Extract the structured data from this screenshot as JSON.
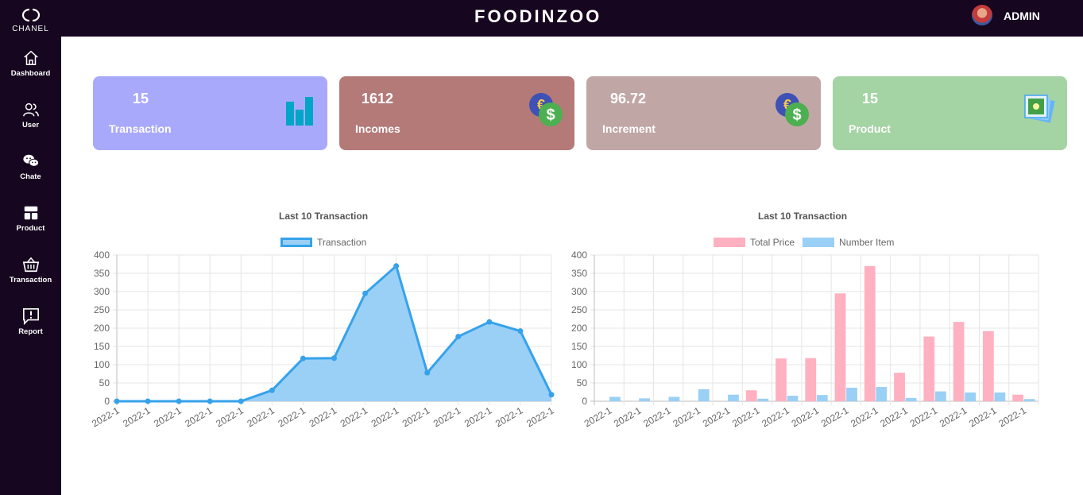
{
  "sidebar": {
    "logo_text": "CHANEL",
    "items": [
      {
        "label": "Dashboard",
        "icon": "home-icon"
      },
      {
        "label": "User",
        "icon": "users-icon"
      },
      {
        "label": "Chate",
        "icon": "chat-icon"
      },
      {
        "label": "Product",
        "icon": "product-icon"
      },
      {
        "label": "Transaction",
        "icon": "basket-icon"
      },
      {
        "label": "Report",
        "icon": "report-icon"
      }
    ]
  },
  "header": {
    "title": "FOODINZOO",
    "user": "ADMIN"
  },
  "cards": [
    {
      "value": "15",
      "label": "Transaction",
      "color": "#a9a9fc",
      "icon": "bar-chart-icon"
    },
    {
      "value": "1612",
      "label": "Incomes",
      "color": "#b37a78",
      "icon": "currency-icon"
    },
    {
      "value": "96.72",
      "label": "Increment",
      "color": "#c1a6a6",
      "icon": "currency-icon"
    },
    {
      "value": "15",
      "label": "Product",
      "color": "#a4d3a4",
      "icon": "photo-stack-icon"
    }
  ],
  "chart_data": [
    {
      "type": "area",
      "title": "Last 10 Transaction",
      "categories": [
        "2022-1",
        "2022-1",
        "2022-1",
        "2022-1",
        "2022-1",
        "2022-1",
        "2022-1",
        "2022-1",
        "2022-1",
        "2022-1",
        "2022-1",
        "2022-1",
        "2022-1",
        "2022-1",
        "2022-1"
      ],
      "series": [
        {
          "name": "Transaction",
          "values": [
            0,
            0,
            0,
            0,
            0,
            30,
            117,
            118,
            295,
            370,
            78,
            177,
            217,
            192,
            18
          ],
          "color": "#36a2eb",
          "fill": "#9ad0f5"
        }
      ],
      "ylim": [
        0,
        400
      ],
      "yticks": [
        0,
        50,
        100,
        150,
        200,
        250,
        300,
        350,
        400
      ],
      "grid": true,
      "legend": "top"
    },
    {
      "type": "bar",
      "title": "Last 10 Transaction",
      "categories": [
        "2022-1",
        "2022-1",
        "2022-1",
        "2022-1",
        "2022-1",
        "2022-1",
        "2022-1",
        "2022-1",
        "2022-1",
        "2022-1",
        "2022-1",
        "2022-1",
        "2022-1",
        "2022-1",
        "2022-1"
      ],
      "series": [
        {
          "name": "Total Price",
          "values": [
            0,
            0,
            0,
            0,
            0,
            30,
            117,
            118,
            295,
            370,
            78,
            177,
            217,
            192,
            18
          ],
          "color": "#ffb1c1"
        },
        {
          "name": "Number Item",
          "values": [
            12,
            8,
            12,
            33,
            18,
            7,
            15,
            17,
            37,
            39,
            9,
            27,
            24,
            24,
            6
          ],
          "color": "#9ad0f5"
        }
      ],
      "ylim": [
        0,
        400
      ],
      "yticks": [
        0,
        50,
        100,
        150,
        200,
        250,
        300,
        350,
        400
      ],
      "grid": true,
      "legend": "top"
    }
  ]
}
